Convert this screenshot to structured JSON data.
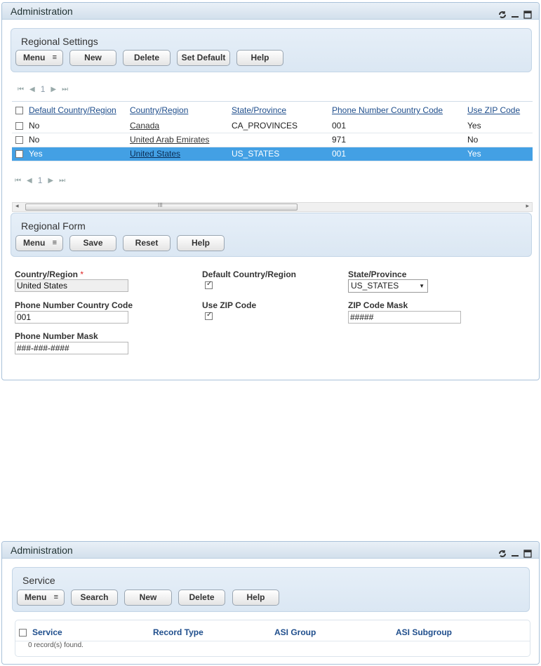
{
  "portlet1": {
    "title": "Administration",
    "regional_settings": {
      "title": "Regional Settings",
      "buttons": {
        "menu": "Menu",
        "new": "New",
        "delete": "Delete",
        "set_default": "Set Default",
        "help": "Help"
      },
      "pager": {
        "page": "1"
      },
      "columns": [
        "Default Country/Region",
        "Country/Region",
        "State/Province",
        "Phone Number Country Code",
        "Use ZIP Code"
      ],
      "rows": [
        {
          "default": "No",
          "country": "Canada",
          "state": "CA_PROVINCES",
          "phone_code": "001",
          "use_zip": "Yes",
          "selected": false
        },
        {
          "default": "No",
          "country": "United Arab Emirates",
          "state": "",
          "phone_code": "971",
          "use_zip": "No",
          "selected": false
        },
        {
          "default": "Yes",
          "country": "United States",
          "state": "US_STATES",
          "phone_code": "001",
          "use_zip": "Yes",
          "selected": true
        }
      ],
      "pager_bottom": {
        "page": "1"
      },
      "scroll_grip": "III"
    },
    "regional_form": {
      "title": "Regional Form",
      "buttons": {
        "menu": "Menu",
        "save": "Save",
        "reset": "Reset",
        "help": "Help"
      },
      "fields": {
        "country_label": "Country/Region",
        "country_required": "*",
        "country_value": "United States",
        "default_label": "Default Country/Region",
        "default_checked": true,
        "state_label": "State/Province",
        "state_value": "US_STATES",
        "phone_code_label": "Phone Number Country Code",
        "phone_code_value": "001",
        "use_zip_label": "Use ZIP Code",
        "use_zip_checked": true,
        "zip_mask_label": "ZIP Code Mask",
        "zip_mask_value": "#####",
        "phone_mask_label": "Phone Number Mask",
        "phone_mask_value": "###-###-####"
      }
    }
  },
  "portlet2": {
    "title": "Administration",
    "service": {
      "title": "Service",
      "buttons": {
        "menu": "Menu",
        "search": "Search",
        "new": "New",
        "delete": "Delete",
        "help": "Help"
      },
      "columns": [
        "Service",
        "Record Type",
        "ASI Group",
        "ASI Subgroup"
      ],
      "empty_message": "0 record(s) found."
    }
  },
  "icons": {
    "refresh": "refresh-icon",
    "minimize": "minimize-icon",
    "maximize": "maximize-icon",
    "menu_arrow": "menu-dropdown-icon",
    "first_page": "first-page-icon",
    "prev_page": "prev-page-icon",
    "next_page": "next-page-icon",
    "last_page": "last-page-icon"
  },
  "colors": {
    "selected_row": "#43a0e4",
    "link": "#1f4e8c",
    "panel": "#dbe7f3"
  }
}
